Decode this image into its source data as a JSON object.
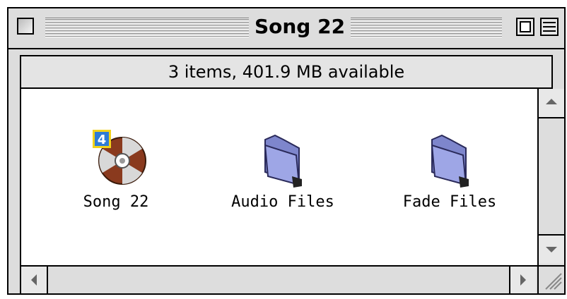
{
  "window": {
    "title": "Song 22",
    "status": "3 items, 401.9 MB available"
  },
  "items": [
    {
      "label": "Song 22",
      "icon": "song-reel-icon",
      "badge": "4"
    },
    {
      "label": "Audio Files",
      "icon": "folder-icon"
    },
    {
      "label": "Fade Files",
      "icon": "folder-icon"
    }
  ],
  "colors": {
    "folder": "#9ea6e6",
    "reel": "#8a3a1e",
    "badge": "#2e7bd6",
    "badge_border": "#f2d21a"
  }
}
